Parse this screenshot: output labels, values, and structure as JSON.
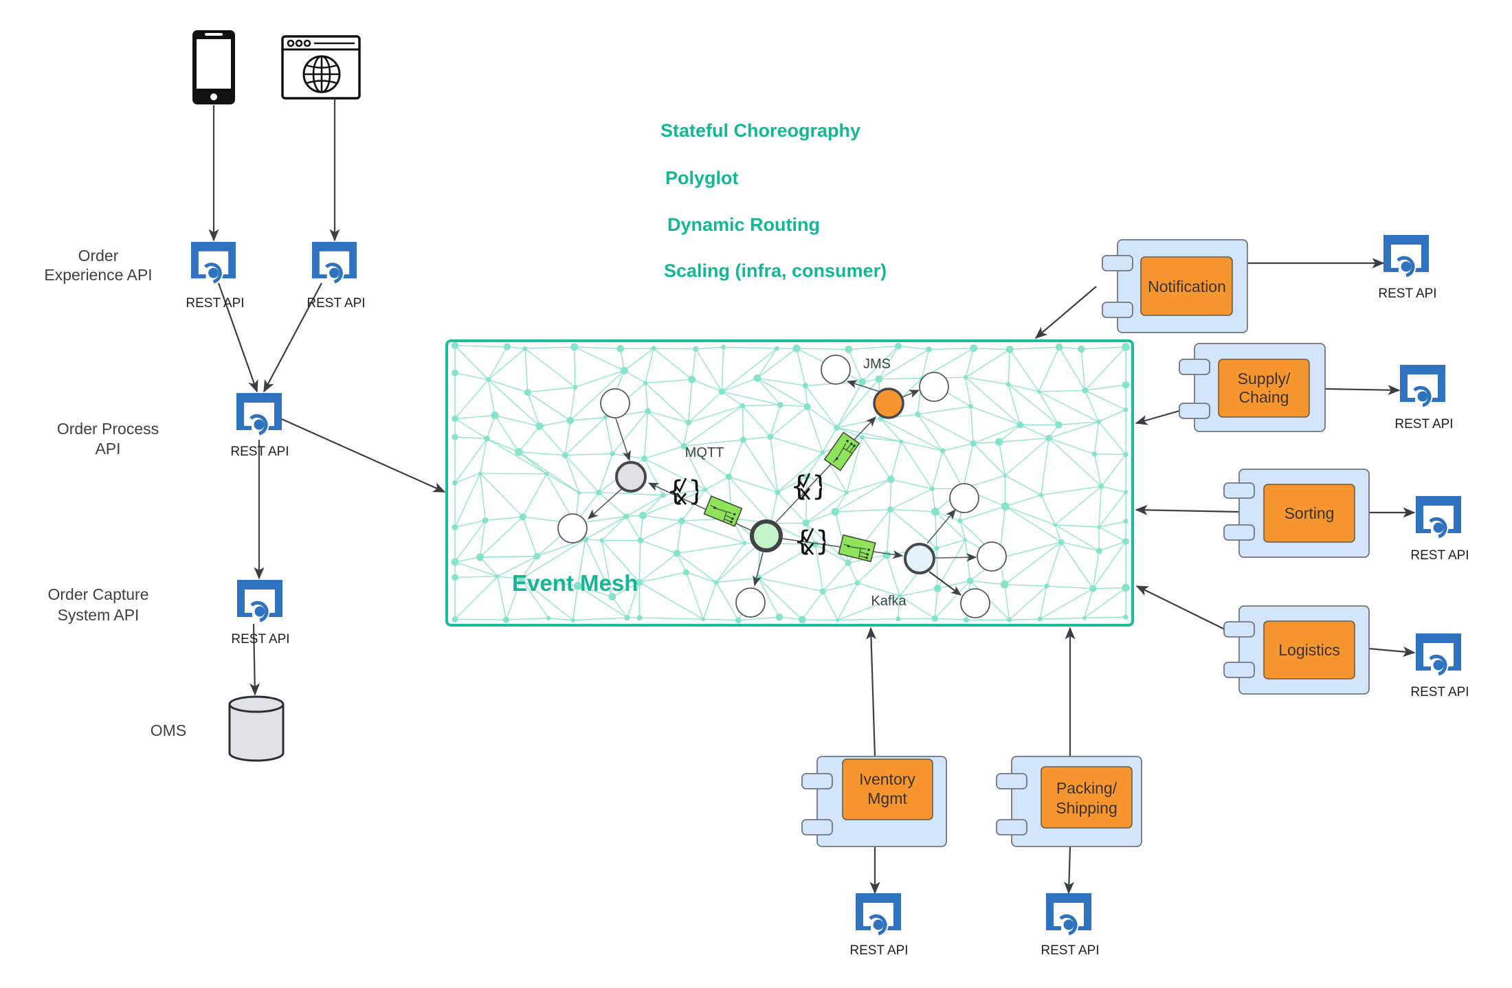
{
  "diagram": {
    "title_points": [
      "Stateful Choreography",
      "Polyglot",
      "Dynamic Routing",
      "Scaling (infra, consumer)"
    ],
    "clients": [
      {
        "id": "mobile",
        "icon": "mobile-phone-icon"
      },
      {
        "id": "web",
        "icon": "web-browser-globe-icon"
      }
    ],
    "layer_labels": {
      "experience": [
        "Order",
        "Experience API"
      ],
      "process": [
        "Order Process",
        "API"
      ],
      "capture": [
        "Order Capture",
        "System API"
      ],
      "oms": "OMS"
    },
    "rest_api_label": "REST API",
    "event_mesh": {
      "label": "Event Mesh",
      "protocols": {
        "mqtt": "MQTT",
        "jms": "JMS",
        "kafka": "Kafka"
      },
      "filter_icon": "filter-rule-check-x-icon",
      "transform_icon": "message-router-icon"
    },
    "services": [
      {
        "id": "notification",
        "lines": [
          "Notification"
        ]
      },
      {
        "id": "supply",
        "lines": [
          "Supply/",
          "Chaing"
        ]
      },
      {
        "id": "sorting",
        "lines": [
          "Sorting"
        ]
      },
      {
        "id": "logistics",
        "lines": [
          "Logistics"
        ]
      },
      {
        "id": "inventory",
        "lines": [
          "Iventory",
          "Mgmt"
        ]
      },
      {
        "id": "packing",
        "lines": [
          "Packing/",
          "Shipping"
        ]
      }
    ],
    "colors": {
      "accent_teal": "#13b795",
      "rest_api_blue": "#2f72c0",
      "service_orange": "#f7952f",
      "service_container": "#d3e5fb",
      "mesh_line": "#7fe0c6",
      "node_orange": "#f7952f",
      "node_green": "#c3f5c8",
      "node_gray": "#dfe1e4",
      "node_lightblue": "#e3f1f8",
      "filter_green": "#8fe35a"
    }
  }
}
